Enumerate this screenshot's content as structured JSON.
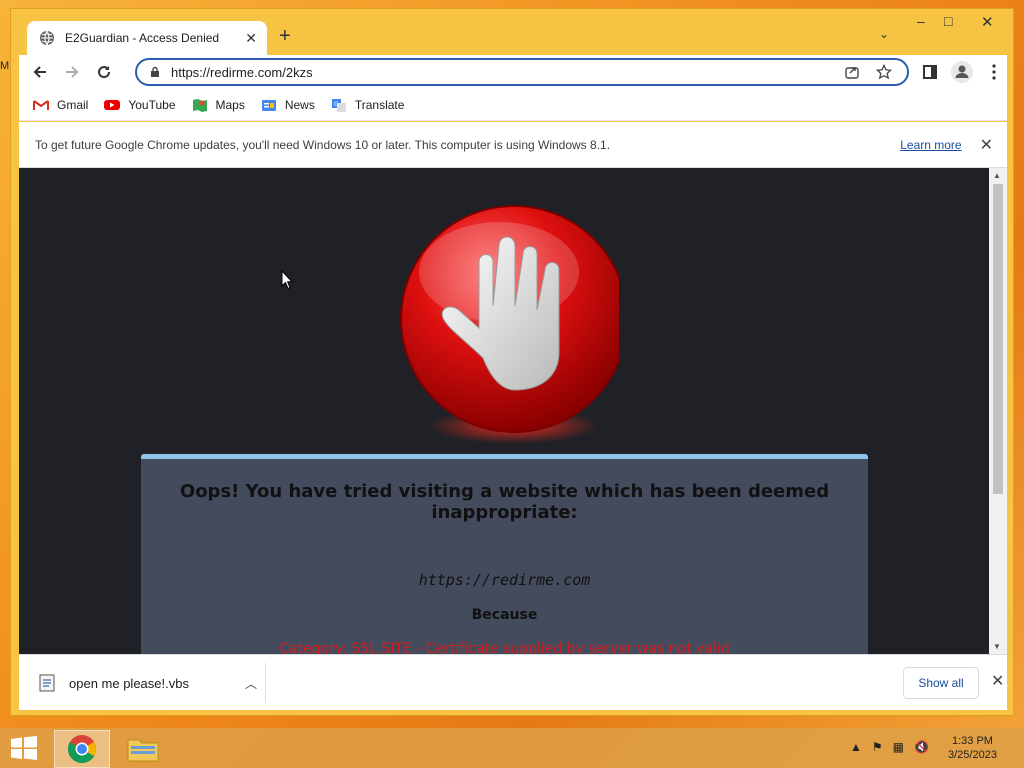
{
  "desktop": {
    "edge_text": "M"
  },
  "tab": {
    "title": "E2Guardian - Access Denied",
    "icon": "globe-icon"
  },
  "toolbar": {
    "url": "https://redirme.com/2kzs"
  },
  "bookmarks": [
    {
      "label": "Gmail",
      "icon": "gmail-icon"
    },
    {
      "label": "YouTube",
      "icon": "youtube-icon"
    },
    {
      "label": "Maps",
      "icon": "maps-icon"
    },
    {
      "label": "News",
      "icon": "news-icon"
    },
    {
      "label": "Translate",
      "icon": "translate-icon"
    }
  ],
  "infobar": {
    "message": "To get future Google Chrome updates, you'll need Windows 10 or later. This computer is using Windows 8.1.",
    "link": "Learn more"
  },
  "page": {
    "headline": "Oops! You have tried visiting a website which has been deemed inappropriate:",
    "site": "https://redirme.com",
    "because": "Because",
    "reason": "Category: SSL SITE - Certificate supplied by server was not valid"
  },
  "downloads": {
    "file_name": "open me please!.vbs",
    "show_all": "Show all"
  },
  "taskbar": {
    "time": "1:33 PM",
    "date": "3/25/2023"
  },
  "colors": {
    "accent": "#2a5fb0",
    "page_bg": "#1f2127",
    "panel_bg": "#444b5d",
    "reason": "#d41e1e"
  }
}
